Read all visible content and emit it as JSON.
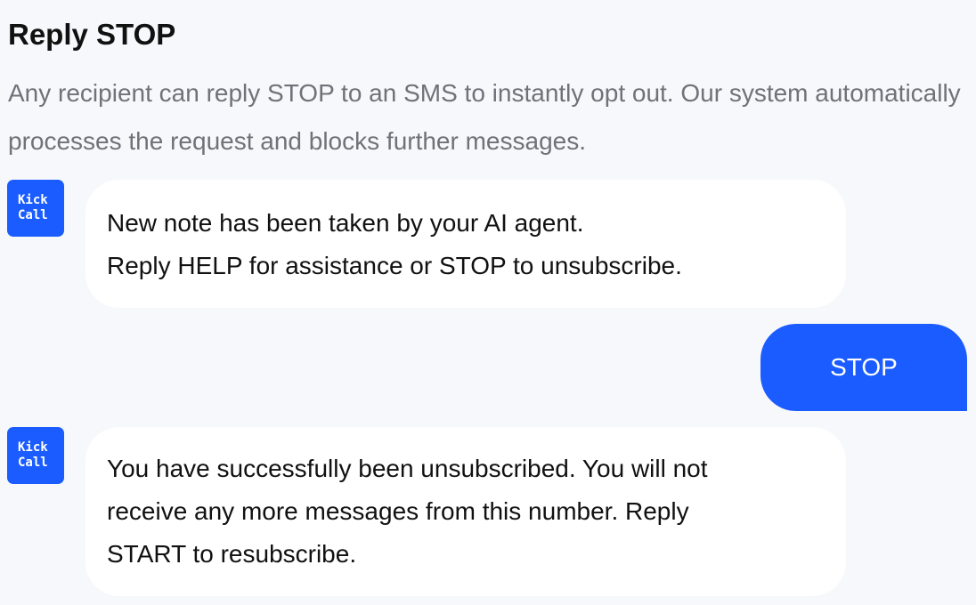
{
  "section": {
    "title": "Reply STOP",
    "description": "Any recipient can reply STOP to an SMS to instantly opt out. Our system automatically processes the request and blocks further messages."
  },
  "avatar": {
    "line1": "Kick",
    "line2": "Call",
    "color": "#1a5cff"
  },
  "messages": [
    {
      "direction": "incoming",
      "lines": [
        "New note has been taken by your AI agent.",
        "Reply HELP for assistance or STOP to unsubscribe."
      ]
    },
    {
      "direction": "outgoing",
      "text": "STOP"
    },
    {
      "direction": "incoming",
      "lines": [
        "You have successfully been unsubscribed. You will not",
        "receive any more messages from this number. Reply",
        "START to resubscribe."
      ]
    }
  ],
  "colors": {
    "accent": "#1a5cff",
    "background": "#f7f8fb",
    "bubble_incoming": "#ffffff",
    "description_text": "#6f7279"
  }
}
